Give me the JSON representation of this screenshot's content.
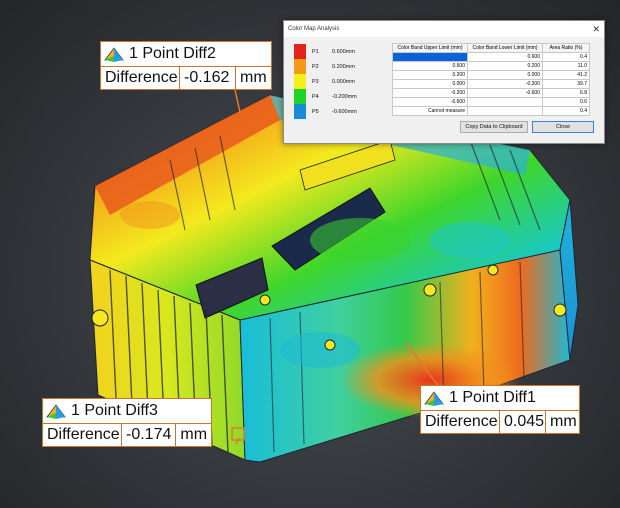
{
  "dialog": {
    "title": "Color Map Analysis",
    "close_glyph": "✕",
    "legend": [
      {
        "label": "P1",
        "value": "0.600mm",
        "color": "#e3241b"
      },
      {
        "label": "P2",
        "value": "0.200mm",
        "color": "#f39a18"
      },
      {
        "label": "P3",
        "value": "0.000mm",
        "color": "#f7ee1e"
      },
      {
        "label": "P4",
        "value": "-0.200mm",
        "color": "#1ed42a"
      },
      {
        "label": "P5",
        "value": "-0.600mm",
        "color": "#1a8bd8"
      }
    ],
    "table": {
      "headers": [
        "Color Band Upper Limit (mm)",
        "Color Band Lower Limit (mm)",
        "Area Ratio (%)"
      ],
      "rows": [
        [
          "",
          "0.600",
          "0.4"
        ],
        [
          "0.600",
          "0.200",
          "11.0"
        ],
        [
          "0.200",
          "0.000",
          "41.2"
        ],
        [
          "0.000",
          "-0.200",
          "39.7"
        ],
        [
          "-0.200",
          "-0.600",
          "6.8"
        ],
        [
          "-0.600",
          "",
          "0.6"
        ],
        [
          "Cannot measure",
          "",
          "0.4"
        ]
      ]
    },
    "copy_label": "Copy Data to Clipboard",
    "close_label": "Close"
  },
  "callouts": [
    {
      "title": "1 Point Diff2",
      "label": "Difference",
      "value": "-0.162",
      "unit": "mm"
    },
    {
      "title": "1 Point Diff1",
      "label": "Difference",
      "value": "0.045",
      "unit": "mm"
    },
    {
      "title": "1 Point Diff3",
      "label": "Difference",
      "value": "-0.174",
      "unit": "mm"
    }
  ],
  "icon_names": {
    "measure": "point-measure-icon"
  }
}
